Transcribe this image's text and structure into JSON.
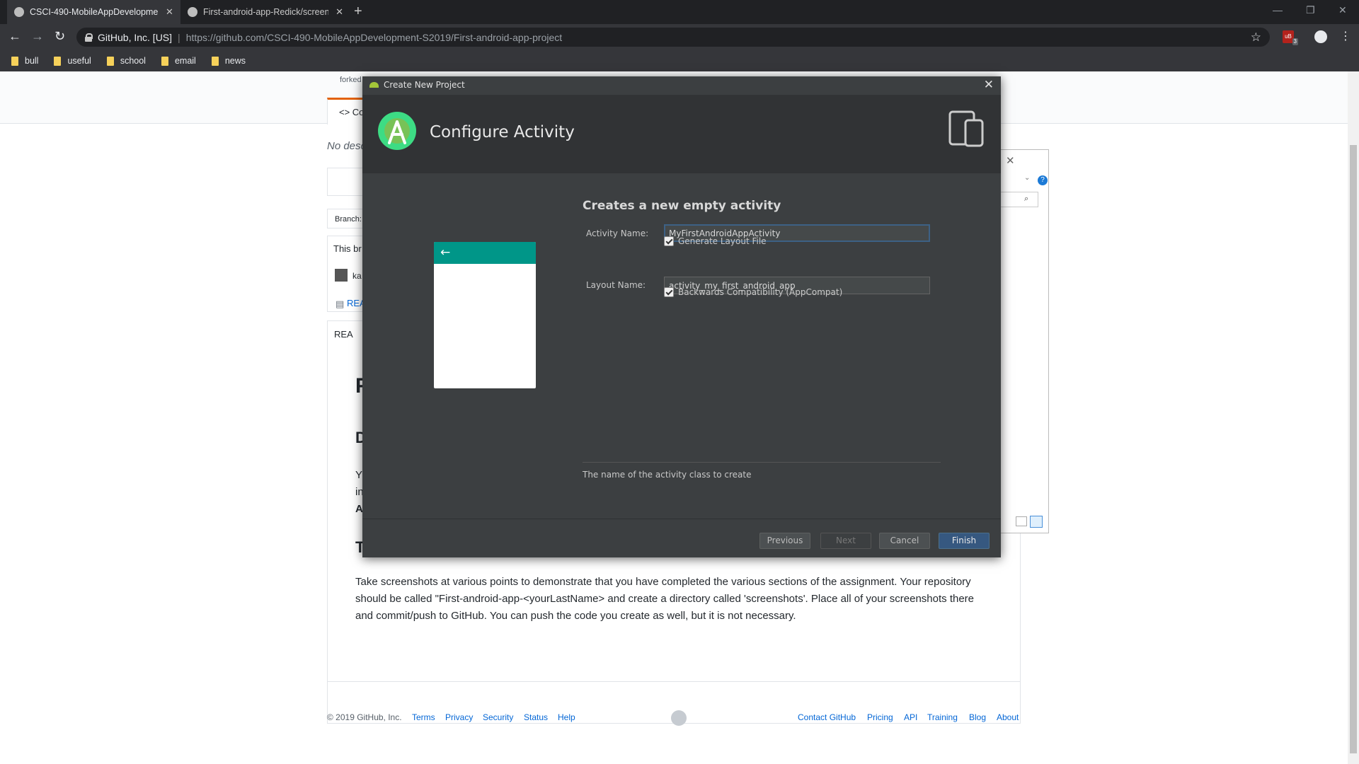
{
  "browser": {
    "tabs": [
      {
        "title": "CSCI-490-MobileAppDevelopme",
        "active": true
      },
      {
        "title": "First-android-app-Redick/screen",
        "active": false
      }
    ],
    "org": "GitHub, Inc. [US]",
    "url": "https://github.com/CSCI-490-MobileAppDevelopment-S2019/First-android-app-project",
    "extension_badge": "3",
    "bookmarks": [
      "bull",
      "useful",
      "school",
      "email",
      "news"
    ]
  },
  "github": {
    "forked_prefix": "forked",
    "code_tab": "<> Co",
    "no_desc": "No desc",
    "branch_label": "Branch:",
    "this_branch": "This br",
    "commit_author": "ka",
    "readme_file": "REA",
    "readme_head": "REA",
    "heading_frag_1": "F",
    "heading_frag_2": "D",
    "line_frag_1": "Y",
    "line_frag_2": "in",
    "line_frag_3": "A",
    "heading_frag_3": "T",
    "paragraph": "Take screenshots at various points to demonstrate that you have completed the various sections of the assignment. Your repository should be called \"First-android-app-<yourLastName> and create a directory called 'screenshots'. Place all of your screenshots there and commit/push to GitHub. You can push the code you create as well, but it is not necessary.",
    "footer_left": [
      "© 2019 GitHub, Inc.",
      "Terms",
      "Privacy",
      "Security",
      "Status",
      "Help"
    ],
    "footer_right": [
      "Contact GitHub",
      "Pricing",
      "API",
      "Training",
      "Blog",
      "About"
    ]
  },
  "dialog": {
    "window_title": "Create New Project",
    "header_title": "Configure Activity",
    "subtitle": "Creates a new empty activity",
    "activity_name_label": "Activity Name:",
    "activity_name_value": "MyFirstAndroidAppActivity",
    "generate_layout_label": "Generate Layout File",
    "layout_name_label": "Layout Name:",
    "layout_name_value": "activity_my_first_android_app",
    "backcompat_label": "Backwards Compatibility (AppCompat)",
    "hint": "The name of the activity class to create",
    "buttons": {
      "previous": "Previous",
      "next": "Next",
      "cancel": "Cancel",
      "finish": "Finish"
    },
    "preview_back_glyph": "←"
  },
  "colors": {
    "dialog_bg": "#3c3f41",
    "header_bg": "#313335",
    "toolbar_teal": "#009688",
    "finish_blue": "#365880",
    "github_link": "#0366d6"
  }
}
